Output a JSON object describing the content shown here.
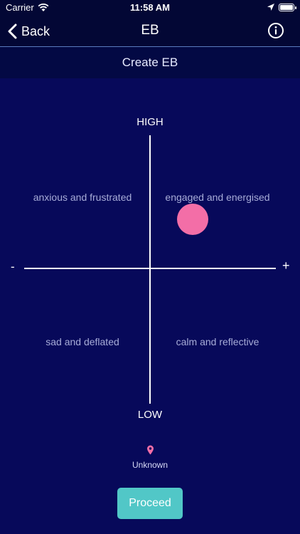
{
  "status_bar": {
    "carrier": "Carrier",
    "time": "11:58 AM"
  },
  "nav": {
    "back_label": "Back",
    "title": "EB"
  },
  "sub_header": {
    "title": "Create EB"
  },
  "plot": {
    "axis_top": "HIGH",
    "axis_bottom": "LOW",
    "axis_left": "-",
    "axis_right": "+",
    "quadrants": {
      "top_left": "anxious and frustrated",
      "top_right": "engaged and energised",
      "bottom_left": "sad and deflated",
      "bottom_right": "calm and reflective"
    },
    "marker_color": "#f36ea7"
  },
  "location": {
    "label": "Unknown",
    "icon": "location-pin-icon"
  },
  "actions": {
    "proceed_label": "Proceed"
  },
  "colors": {
    "background": "#07095a",
    "nav_background": "#030735",
    "accent": "#51c7c7"
  }
}
